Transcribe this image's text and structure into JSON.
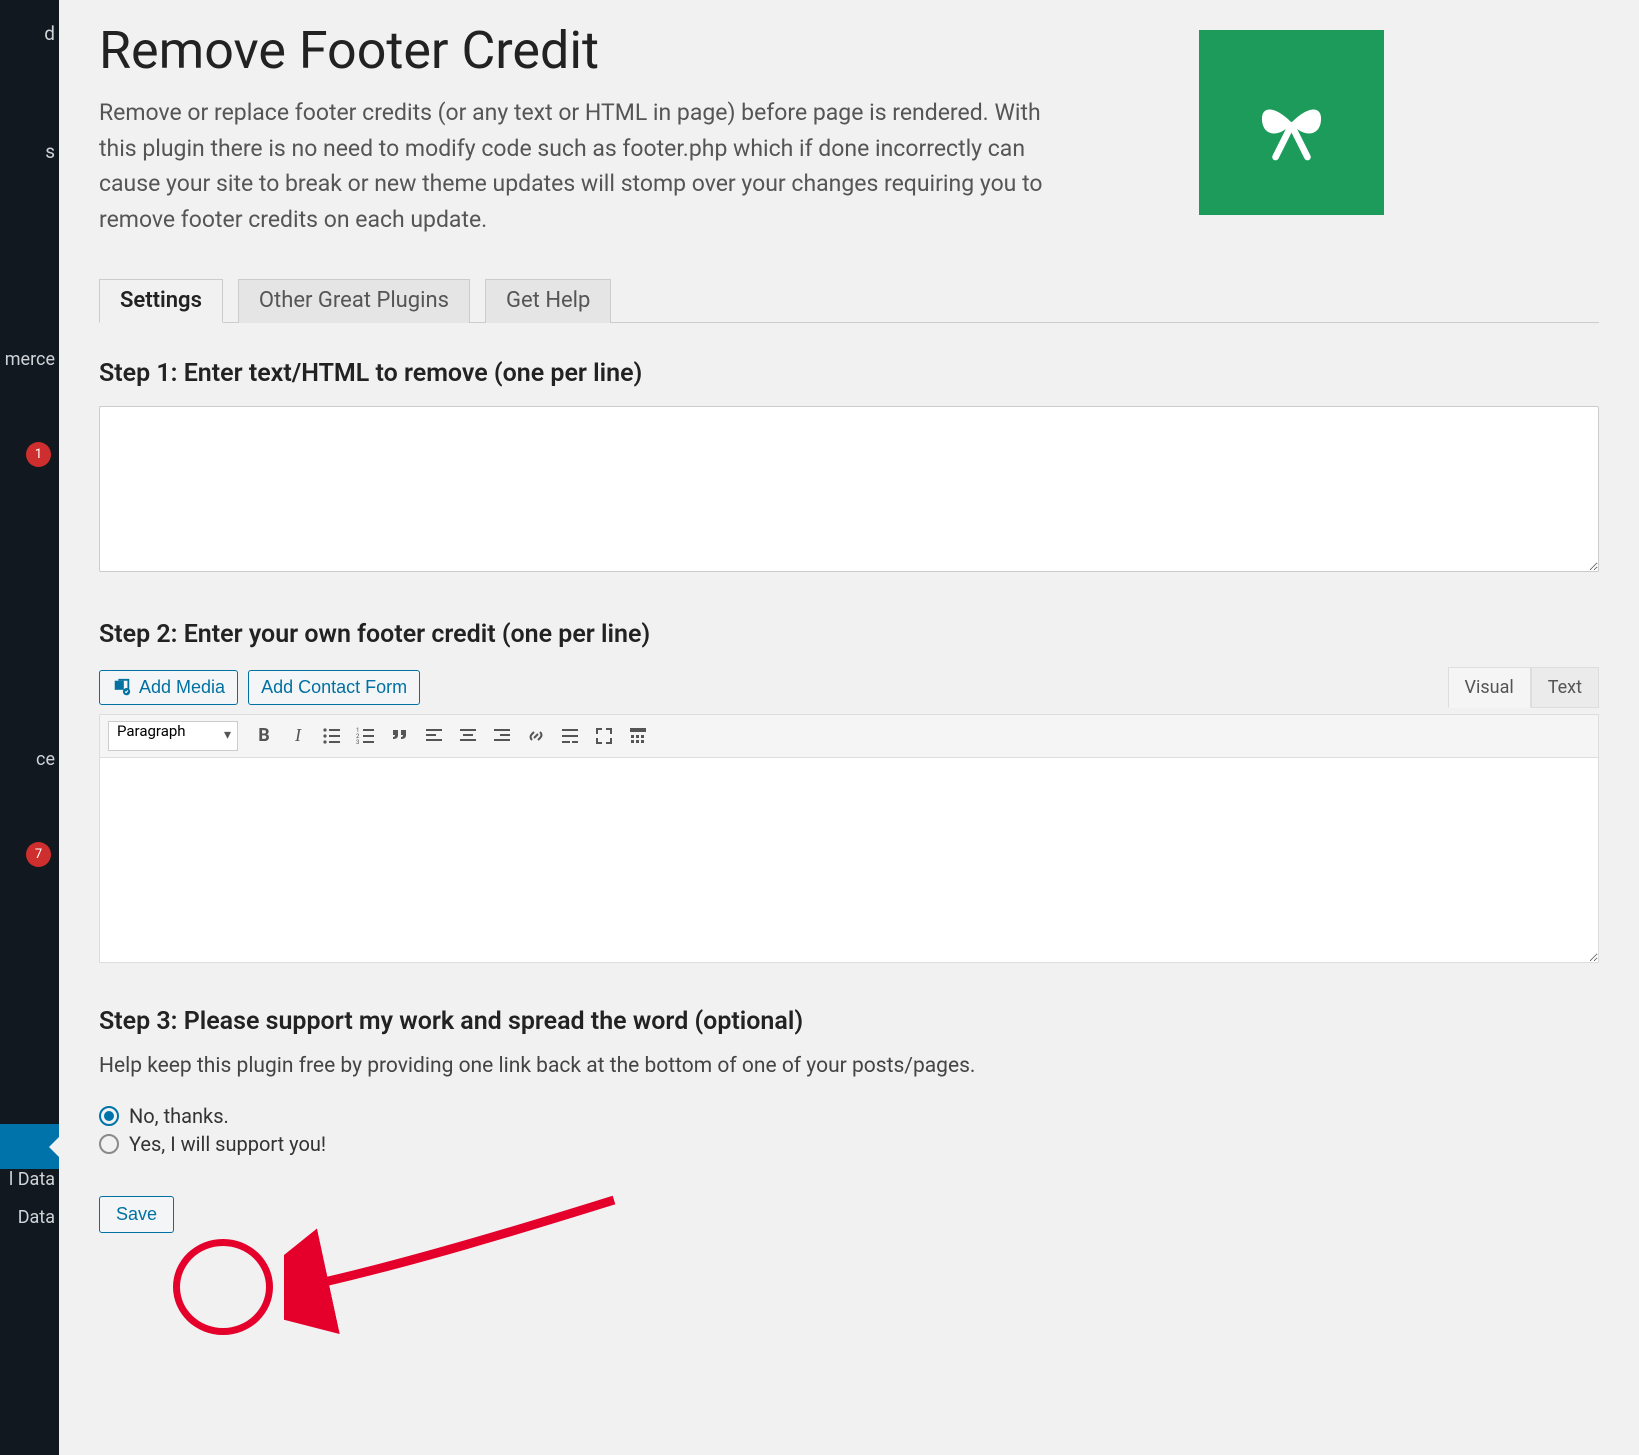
{
  "sidebar": {
    "items": [
      {
        "label": "d"
      },
      {
        "label": ""
      },
      {
        "label": "s"
      },
      {
        "label": ""
      },
      {
        "label": ""
      },
      {
        "label": "merce"
      },
      {
        "label": ""
      },
      {
        "label": "",
        "badge": "1"
      },
      {
        "label": ""
      },
      {
        "label": ""
      },
      {
        "label": ""
      },
      {
        "label": ""
      },
      {
        "label": ""
      },
      {
        "label": ""
      },
      {
        "label": "ce"
      },
      {
        "label": ""
      },
      {
        "label": "",
        "badge": "7"
      },
      {
        "label": ""
      },
      {
        "label": ""
      },
      {
        "label": ""
      },
      {
        "label": ""
      },
      {
        "label": ""
      },
      {
        "label": ""
      },
      {
        "label": ""
      },
      {
        "label": "l Data"
      },
      {
        "label": "Data"
      }
    ]
  },
  "page": {
    "title": "Remove Footer Credit",
    "intro": "Remove or replace footer credits (or any text or HTML in page) before page is rendered. With this plugin there is no need to modify code such as footer.php which if done incorrectly can cause your site to break or new theme updates will stomp over your changes requiring you to remove footer credits on each update."
  },
  "tabs": [
    {
      "label": "Settings",
      "active": true
    },
    {
      "label": "Other Great Plugins",
      "active": false
    },
    {
      "label": "Get Help",
      "active": false
    }
  ],
  "step1": {
    "heading": "Step 1: Enter text/HTML to remove (one per line)",
    "value": ""
  },
  "step2": {
    "heading": "Step 2: Enter your own footer credit (one per line)",
    "add_media_label": "Add Media",
    "add_contact_label": "Add Contact Form",
    "editor_tabs": {
      "visual": "Visual",
      "text": "Text"
    },
    "paragraph_label": "Paragraph",
    "value": ""
  },
  "step3": {
    "heading": "Step 3: Please support my work and spread the word (optional)",
    "desc": "Help keep this plugin free by providing one link back at the bottom of one of your posts/pages.",
    "options": [
      {
        "label": "No, thanks.",
        "checked": true
      },
      {
        "label": "Yes, I will support you!",
        "checked": false
      }
    ]
  },
  "save_label": "Save"
}
